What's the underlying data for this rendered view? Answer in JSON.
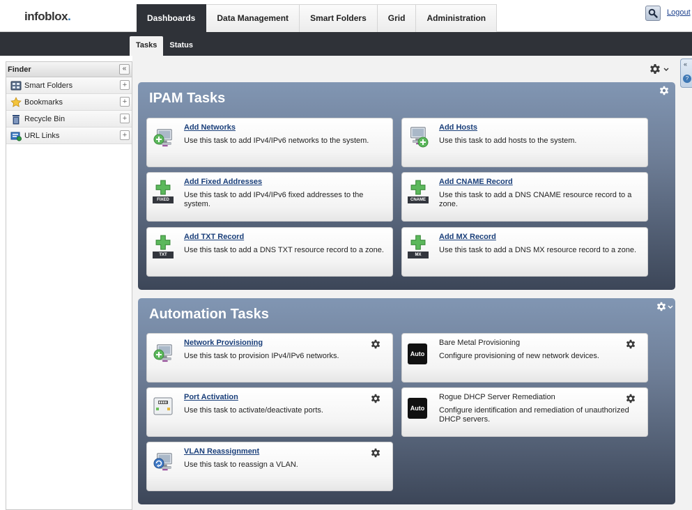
{
  "brand": {
    "logo_main": "infoblox",
    "logo_dot": "."
  },
  "main_tabs": [
    {
      "label": "Dashboards"
    },
    {
      "label": "Data Management"
    },
    {
      "label": "Smart Folders"
    },
    {
      "label": "Grid"
    },
    {
      "label": "Administration"
    }
  ],
  "header": {
    "logout": "Logout",
    "search_icon": "search-icon"
  },
  "sub_tabs": [
    {
      "label": "Tasks"
    },
    {
      "label": "Status"
    }
  ],
  "finder": {
    "title": "Finder",
    "collapse": "«",
    "items": [
      {
        "label": "Smart Folders",
        "icon": "smart-folder-icon",
        "action": "+"
      },
      {
        "label": "Bookmarks",
        "icon": "star-icon",
        "action": "+"
      },
      {
        "label": "Recycle Bin",
        "icon": "trash-icon",
        "action": "+"
      },
      {
        "label": "URL Links",
        "icon": "url-link-icon",
        "action": "+"
      }
    ]
  },
  "right_tab": {
    "arrow": "«",
    "help": "?"
  },
  "ipam": {
    "title": "IPAM Tasks",
    "cards": [
      {
        "title": "Add Networks",
        "desc": "Use this task to add IPv4/IPv6 networks to the system.",
        "icon": "add-network-icon"
      },
      {
        "title": "Add Hosts",
        "desc": "Use this task to add hosts to the system.",
        "icon": "add-host-icon"
      },
      {
        "title": "Add Fixed Addresses",
        "desc": "Use this task to add IPv4/IPv6 fixed addresses to the system.",
        "icon": "add-fixed-icon",
        "badge": "FIXED"
      },
      {
        "title": "Add CNAME Record",
        "desc": "Use this task to add a DNS CNAME resource record to a zone.",
        "icon": "add-cname-icon",
        "badge": "CNAME"
      },
      {
        "title": "Add TXT Record",
        "desc": "Use this task to add a DNS TXT resource record to a zone.",
        "icon": "add-txt-icon",
        "badge": "TXT"
      },
      {
        "title": "Add MX Record",
        "desc": "Use this task to add a DNS MX resource record to a zone.",
        "icon": "add-mx-icon",
        "badge": "MX"
      }
    ]
  },
  "automation": {
    "title": "Automation Tasks",
    "cards": [
      {
        "title": "Network Provisioning",
        "desc": "Use this task to provision IPv4/IPv6 networks.",
        "icon": "network-provisioning-icon"
      },
      {
        "title": "Bare Metal Provisioning",
        "desc": "Configure provisioning of new network devices.",
        "icon": "auto-icon",
        "badge": "Auto"
      },
      {
        "title": "Port Activation",
        "desc": "Use this task to activate/deactivate ports.",
        "icon": "port-activation-icon"
      },
      {
        "title": "Rogue DHCP Server Remediation",
        "desc": "Configure identification and remediation of unauthorized DHCP servers.",
        "icon": "auto-icon",
        "badge": "Auto"
      },
      {
        "title": "VLAN Reassignment",
        "desc": "Use this task to reassign a VLAN.",
        "icon": "vlan-reassignment-icon"
      }
    ]
  },
  "colors": {
    "dark_bar": "#2f3238",
    "panel_top": "#8196b3",
    "panel_bottom": "#3c4658",
    "link": "#1a3f7a",
    "add_green": "#5cb85c"
  }
}
